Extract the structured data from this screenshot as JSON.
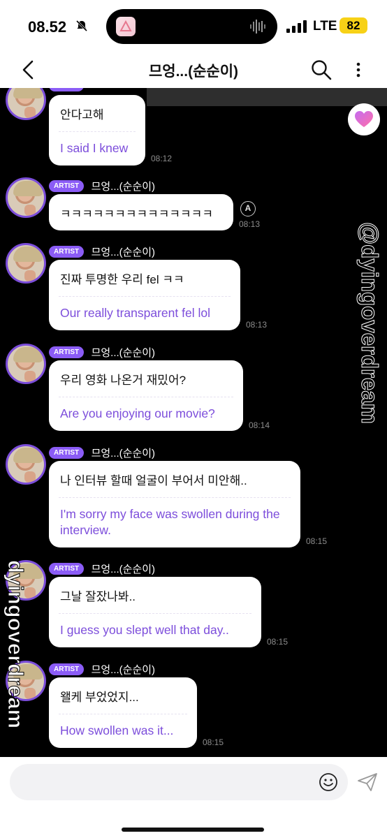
{
  "status_bar": {
    "time": "08.52",
    "network": "LTE",
    "battery": "82"
  },
  "header": {
    "title": "므엉...(순순이)"
  },
  "messages": [
    {
      "badge": "",
      "sender": "",
      "ko": "안다고해",
      "en": "I said I knew",
      "time": "08:12"
    },
    {
      "badge": "ARTIST",
      "sender": "므엉...(순순이)",
      "ko": "ㅋㅋㅋㅋㅋㅋㅋㅋㅋㅋㅋㅋㅋㅋ",
      "en": "",
      "time": "08:13",
      "translate_icon": "A"
    },
    {
      "badge": "ARTIST",
      "sender": "므엉...(순순이)",
      "ko": "진짜 투명한 우리 fel ㅋㅋ",
      "en": "Our really transparent fel lol",
      "time": "08:13"
    },
    {
      "badge": "ARTIST",
      "sender": "므엉...(순순이)",
      "ko": "우리 영화 나온거 재밌어?",
      "en": "Are you enjoying our movie?",
      "time": "08:14"
    },
    {
      "badge": "ARTIST",
      "sender": "므엉...(순순이)",
      "ko": "나 인터뷰 할때 얼굴이 부어서 미안해..",
      "en": "I'm sorry my face was swollen during the interview.",
      "time": "08:15"
    },
    {
      "badge": "ARTIST",
      "sender": "므엉...(순순이)",
      "ko": "그날 잘잤나봐..",
      "en": "I guess you slept well that day..",
      "time": "08:15"
    },
    {
      "badge": "ARTIST",
      "sender": "므엉...(순순이)",
      "ko": "왤케 부었었지...",
      "en": "How swollen was it...",
      "time": "08:15"
    }
  ],
  "watermark": {
    "right": "@dyingoverdream",
    "left": "dyingoverdream"
  },
  "colors": {
    "accent": "#8b5cf6",
    "translation": "#7c4ddb",
    "chat_background": "#000000"
  },
  "icons": [
    "back-arrow-icon",
    "search-icon",
    "more-icon",
    "heart-icon",
    "emoji-icon",
    "send-icon",
    "bell-muted-icon",
    "signal-icon"
  ]
}
